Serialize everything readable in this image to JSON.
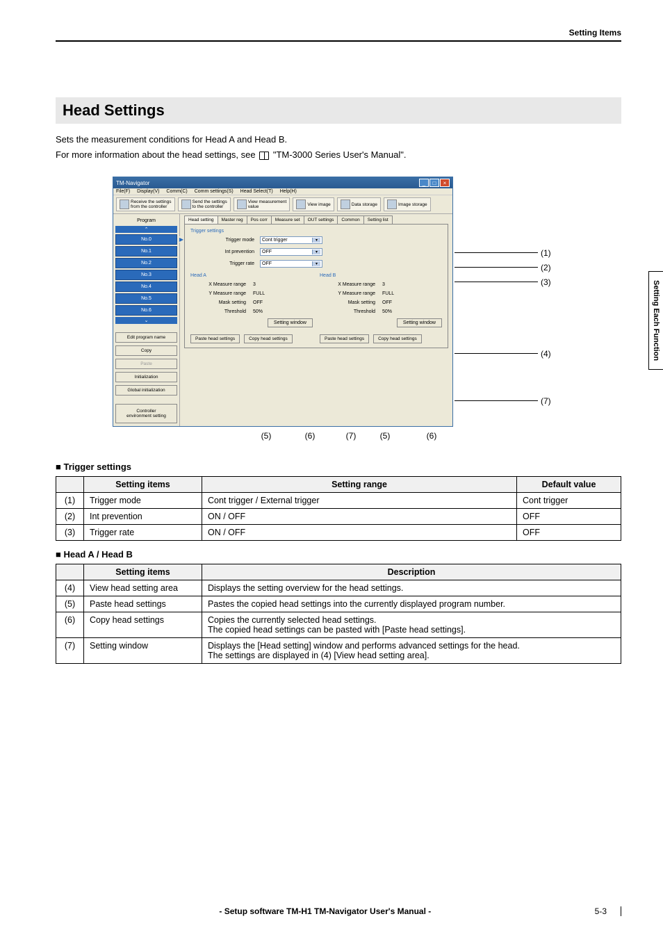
{
  "header": {
    "breadcrumb": "Setting Items"
  },
  "section": {
    "title": "Head Settings",
    "intro_line1": "Sets the measurement conditions for Head A and Head B.",
    "intro_line2_before": "For more information about the head settings, see ",
    "intro_line2_after": " \"TM-3000 Series User's Manual\"."
  },
  "side_tab": "Setting Each Function",
  "app": {
    "title": "TM-Navigator",
    "menu": [
      "File(F)",
      "Display(V)",
      "Comm(C)",
      "Comm settings(S)",
      "Head Select(T)",
      "Help(H)"
    ],
    "toolbar": {
      "receive": "Receive the settings\nfrom the controller",
      "send": "Send the settings\nto the controller",
      "view_meas": "View measurement\nvalue",
      "view_image": "View image",
      "data_storage": "Data storage",
      "image_storage": "Image storage"
    },
    "left": {
      "program_label": "Program",
      "items": [
        "No.0",
        "No.1",
        "No.2",
        "No.3",
        "No.4",
        "No.5",
        "No.6"
      ],
      "edit_name": "Edit program name",
      "copy": "Copy",
      "paste": "Paste",
      "init": "Initialization",
      "global_init": "Global initialization",
      "ctrl_env": "Controller\nenvironment setting"
    },
    "tabs": [
      "Head setting",
      "Master reg",
      "Pos corr",
      "Measure set",
      "OUT settings",
      "Common",
      "Setting list"
    ],
    "trigger": {
      "legend": "Trigger settings",
      "mode_label": "Trigger mode",
      "mode_value": "Cont trigger",
      "int_label": "Int prevention",
      "int_value": "OFF",
      "rate_label": "Trigger rate",
      "rate_value": "OFF"
    },
    "headA": {
      "legend": "Head A",
      "rows": [
        {
          "label": "X Measure range",
          "value": "3"
        },
        {
          "label": "Y Measure range",
          "value": "FULL"
        },
        {
          "label": "Mask setting",
          "value": "OFF"
        },
        {
          "label": "Threshold",
          "value": "50%"
        }
      ],
      "setting_window": "Setting window",
      "paste": "Paste head settings",
      "copy": "Copy head settings"
    },
    "headB": {
      "legend": "Head B",
      "rows": [
        {
          "label": "X Measure range",
          "value": "3"
        },
        {
          "label": "Y Measure range",
          "value": "FULL"
        },
        {
          "label": "Mask setting",
          "value": "OFF"
        },
        {
          "label": "Threshold",
          "value": "50%"
        }
      ],
      "setting_window": "Setting window",
      "paste": "Paste head settings",
      "copy": "Copy head settings"
    }
  },
  "callouts": {
    "c1": "(1)",
    "c2": "(2)",
    "c3": "(3)",
    "c4": "(4)",
    "c5a": "(5)",
    "c6a": "(6)",
    "c7a": "(7)",
    "c5b": "(5)",
    "c6b": "(6)",
    "c7_right": "(7)"
  },
  "trigger_section": {
    "heading": "Trigger settings",
    "col1": "Setting items",
    "col2": "Setting range",
    "col3": "Default value",
    "rows": [
      {
        "idx": "(1)",
        "item": "Trigger mode",
        "range": "Cont trigger / External trigger",
        "def": "Cont trigger"
      },
      {
        "idx": "(2)",
        "item": "Int prevention",
        "range": "ON / OFF",
        "def": "OFF"
      },
      {
        "idx": "(3)",
        "item": "Trigger rate",
        "range": "ON / OFF",
        "def": "OFF"
      }
    ]
  },
  "headab_section": {
    "heading": "Head A / Head B",
    "col1": "Setting items",
    "col2": "Description",
    "rows": [
      {
        "idx": "(4)",
        "item": "View head setting area",
        "desc": "Displays the setting overview for the head settings."
      },
      {
        "idx": "(5)",
        "item": "Paste head settings",
        "desc": "Pastes the copied head settings into the currently displayed program number."
      },
      {
        "idx": "(6)",
        "item": "Copy head settings",
        "desc": "Copies the currently selected head settings.\nThe copied head settings can be pasted with [Paste head settings]."
      },
      {
        "idx": "(7)",
        "item": "Setting window",
        "desc": "Displays the [Head setting] window and performs advanced settings for the head.\nThe settings are displayed in (4) [View head setting area]."
      }
    ]
  },
  "footer": {
    "title": "- Setup software TM-H1 TM-Navigator User's Manual -",
    "page": "5-3"
  }
}
